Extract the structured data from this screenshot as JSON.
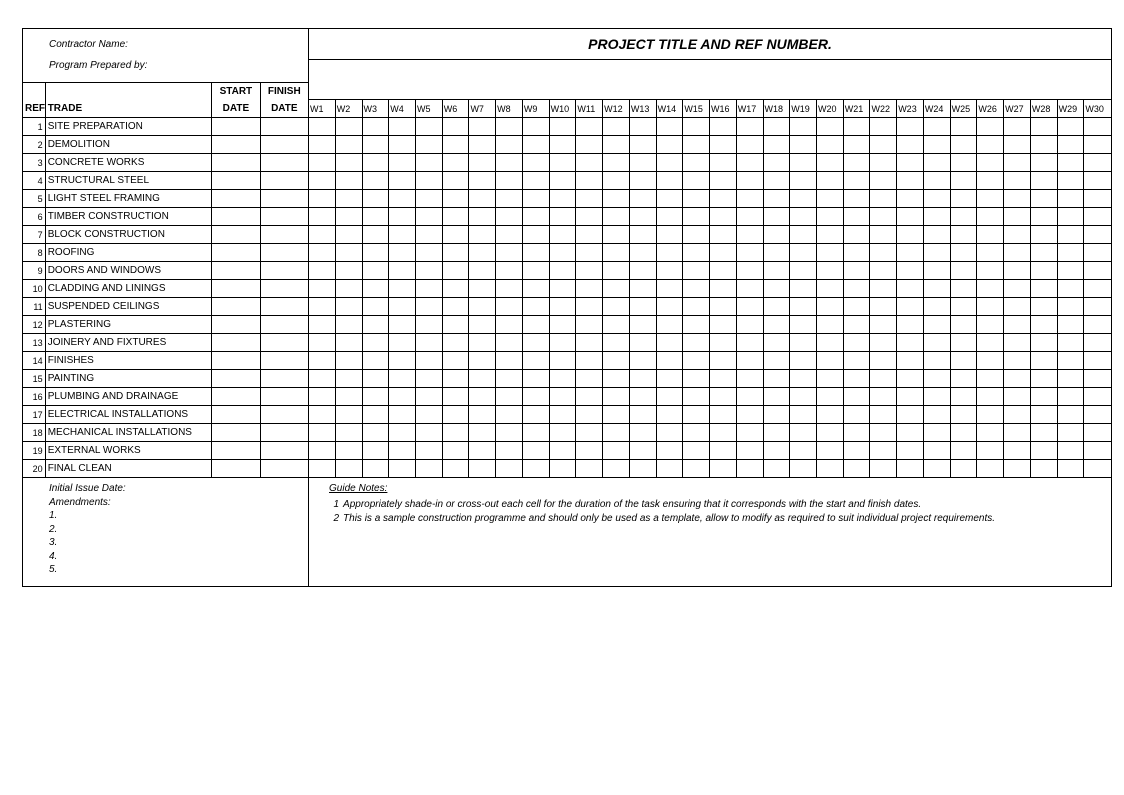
{
  "header": {
    "contractor_label": "Contractor Name:",
    "prepared_label": "Program Prepared by:",
    "project_title": "PROJECT TITLE AND REF NUMBER."
  },
  "columns": {
    "ref": "REF",
    "trade": "TRADE",
    "start_top": "START",
    "start_bot": "DATE",
    "finish_top": "FINISH",
    "finish_bot": "DATE"
  },
  "weeks": [
    "W1",
    "W2",
    "W3",
    "W4",
    "W5",
    "W6",
    "W7",
    "W8",
    "W9",
    "W10",
    "W11",
    "W12",
    "W13",
    "W14",
    "W15",
    "W16",
    "W17",
    "W18",
    "W19",
    "W20",
    "W21",
    "W22",
    "W23",
    "W24",
    "W25",
    "W26",
    "W27",
    "W28",
    "W29",
    "W30"
  ],
  "rows": [
    {
      "ref": "1",
      "trade": "SITE PREPARATION"
    },
    {
      "ref": "2",
      "trade": "DEMOLITION"
    },
    {
      "ref": "3",
      "trade": "CONCRETE WORKS"
    },
    {
      "ref": "4",
      "trade": "STRUCTURAL STEEL"
    },
    {
      "ref": "5",
      "trade": "LIGHT STEEL FRAMING"
    },
    {
      "ref": "6",
      "trade": "TIMBER CONSTRUCTION"
    },
    {
      "ref": "7",
      "trade": "BLOCK CONSTRUCTION"
    },
    {
      "ref": "8",
      "trade": "ROOFING"
    },
    {
      "ref": "9",
      "trade": "DOORS AND WINDOWS"
    },
    {
      "ref": "10",
      "trade": "CLADDING AND LININGS"
    },
    {
      "ref": "11",
      "trade": "SUSPENDED CEILINGS"
    },
    {
      "ref": "12",
      "trade": "PLASTERING"
    },
    {
      "ref": "13",
      "trade": "JOINERY AND FIXTURES"
    },
    {
      "ref": "14",
      "trade": "FINISHES"
    },
    {
      "ref": "15",
      "trade": "PAINTING"
    },
    {
      "ref": "16",
      "trade": "PLUMBING AND DRAINAGE"
    },
    {
      "ref": "17",
      "trade": "ELECTRICAL INSTALLATIONS"
    },
    {
      "ref": "18",
      "trade": "MECHANICAL INSTALLATIONS"
    },
    {
      "ref": "19",
      "trade": "EXTERNAL WORKS"
    },
    {
      "ref": "20",
      "trade": "FINAL CLEAN"
    }
  ],
  "footer": {
    "issue_label": "Initial Issue Date:",
    "amend_label": "Amendments:",
    "amend_nums": [
      "1.",
      "2.",
      "3.",
      "4.",
      "5."
    ],
    "notes_title": "Guide Notes:",
    "notes": [
      {
        "n": "1",
        "t": "Appropriately shade-in or cross-out each cell for the duration of the task ensuring that it corresponds with the start and finish dates."
      },
      {
        "n": "2",
        "t": "This is a sample construction programme and should only be used as a template, allow to modify as required to suit individual project requirements."
      }
    ]
  }
}
